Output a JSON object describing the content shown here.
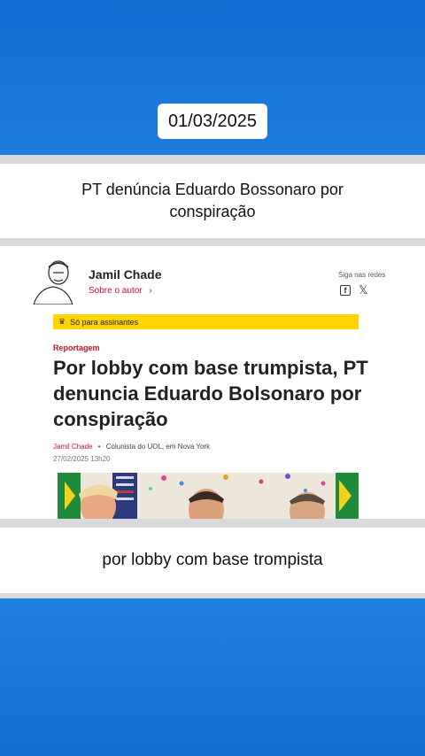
{
  "date_badge": "01/03/2025",
  "headline": "PT denúncia Eduardo Bossonaro por conspiração",
  "article": {
    "author": "Jamil Chade",
    "author_link": "Sobre o autor",
    "author_link_arrow": "›",
    "social_label": "Siga nas redes",
    "facebook_glyph": "f",
    "x_glyph": "𝕏",
    "subscriber_label": "Só para assinantes",
    "crown_glyph": "♛",
    "kicker": "Reportagem",
    "title": "Por lobby com base trumpista, PT denuncia Eduardo Bolsonaro por conspiração",
    "byline_author": "Jamil Chade",
    "byline_dot": "•",
    "byline_role": "Colunista do UOL, em Nova York",
    "timestamp": "27/02/2025 13h20"
  },
  "caption": "por lobby com base trompista",
  "colors": {
    "background_blue": "#1d76d6",
    "accent_red": "#c8102e",
    "subscriber_yellow": "#ffd400"
  }
}
